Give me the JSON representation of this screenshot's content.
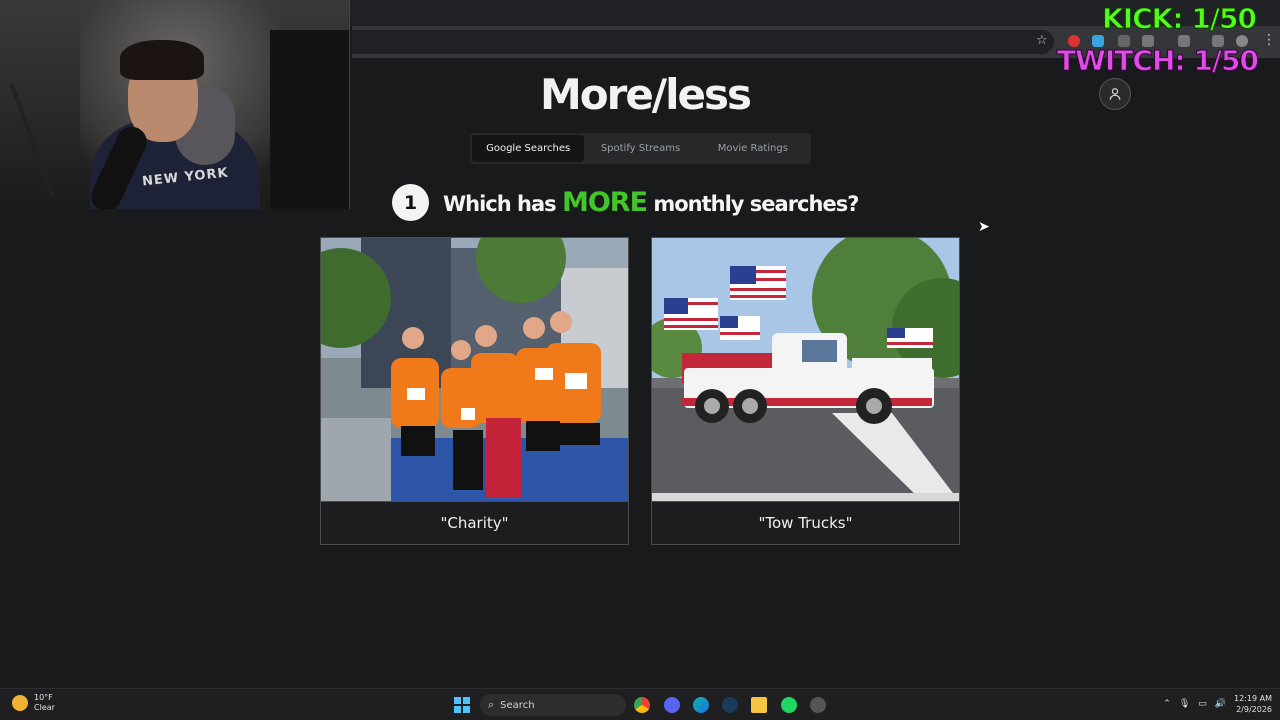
{
  "overlay": {
    "kick": "KICK: 1/50",
    "twitch": "TWITCH: 1/50"
  },
  "webcam": {
    "shirt_text": "NEW YORK"
  },
  "app": {
    "logo": "More/less"
  },
  "tabs": [
    {
      "label": "Google Searches",
      "active": true
    },
    {
      "label": "Spotify Streams",
      "active": false
    },
    {
      "label": "Movie Ratings",
      "active": false
    }
  ],
  "question": {
    "number": "1",
    "before": "Which has",
    "emphasis": "MORE",
    "after": "monthly searches?",
    "emphasis_color": "#44c52b"
  },
  "options": [
    {
      "label": "\"Charity\"",
      "image": "charity-runners-photo"
    },
    {
      "label": "\"Tow Trucks\"",
      "image": "tow-truck-flags-photo"
    }
  ],
  "taskbar": {
    "weather_temp": "10°F",
    "weather_cond": "Clear",
    "search_label": "Search",
    "time": "12:19 AM",
    "date": "2/9/2026"
  },
  "icons": {
    "profile": "user-icon",
    "bookmark": "star-icon"
  }
}
